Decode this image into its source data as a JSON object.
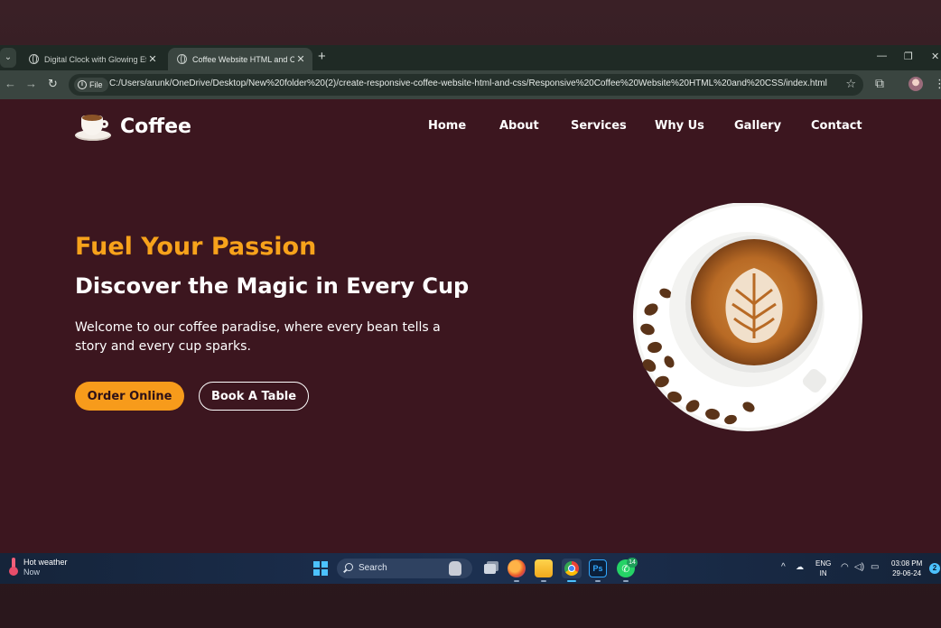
{
  "browser": {
    "tabs": [
      {
        "title": "Digital Clock with Glowing Effe"
      },
      {
        "title": "Coffee Website HTML and CSS"
      }
    ],
    "new_tab_icon": "plus",
    "url_chip": "File",
    "url": "C:/Users/arunk/OneDrive/Desktop/New%20folder%20(2)/create-responsive-coffee-website-html-and-css/Responsive%20Coffee%20Website%20HTML%20and%20CSS/index.html",
    "window_controls": [
      "—",
      "❐",
      "✕"
    ]
  },
  "site": {
    "brand": "Coffee",
    "nav": [
      "Home",
      "About",
      "Services",
      "Why Us",
      "Gallery",
      "Contact"
    ],
    "hero": {
      "kicker": "Fuel Your Passion",
      "title": "Discover the Magic in Every Cup",
      "description": "Welcome to our coffee paradise, where every bean tells a story and every cup sparks.",
      "buttons": {
        "primary": "Order Online",
        "secondary": "Book A Table"
      }
    },
    "colors": {
      "background": "#3c161f",
      "accent": "#f79b1b",
      "text": "#ffffff"
    }
  },
  "taskbar": {
    "weather": {
      "title": "Hot weather",
      "subtitle": "Now"
    },
    "search_label": "Search",
    "whatsapp_badge": "14",
    "language": {
      "line1": "ENG",
      "line2": "IN"
    },
    "time": "03:08 PM",
    "date": "29-06-24",
    "notifications": "2"
  }
}
